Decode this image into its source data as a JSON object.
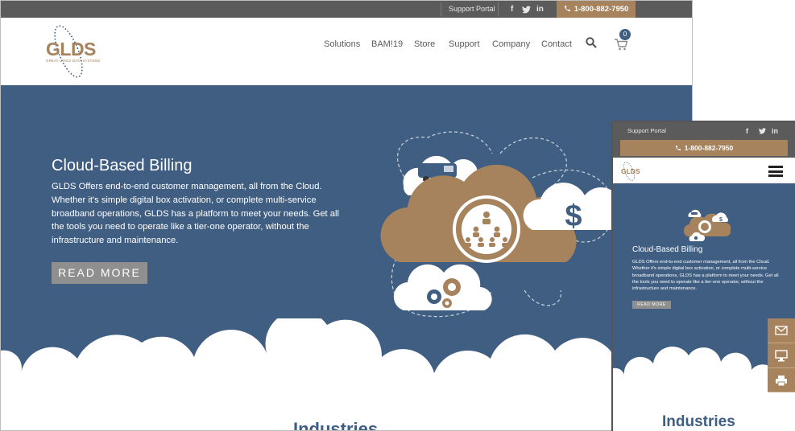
{
  "desktop": {
    "topbar": {
      "support_portal": "Support Portal",
      "social": [
        "f",
        "t",
        "in"
      ],
      "phone": "1-800-882-7950"
    },
    "logo": {
      "text": "GLDS",
      "tagline": "GREAT LAKES DATA SYSTEMS"
    },
    "nav": [
      "Solutions",
      "BAM!19",
      "Store",
      "Support",
      "Company",
      "Contact"
    ],
    "cart_count": "0",
    "hero": {
      "title": "Cloud-Based Billing",
      "body": "GLDS Offers end-to-end customer management, all from the Cloud. Whether it's simple digital box activation, or complete multi-service broadband operations, GLDS has a platform to meet your needs. Get all the tools you need to operate like a tier-one operator, without the infrastructure and maintenance.",
      "button": "READ MORE"
    },
    "section_heading": "Industries"
  },
  "mobile": {
    "support_portal": "Support Portal",
    "social": [
      "f",
      "t",
      "in"
    ],
    "phone": "1-800-882-7950",
    "logo_text": "GLDS",
    "hero_title": "Cloud-Based Billing",
    "hero_body": "GLDS Offers end-to-end customer management, all from the Cloud. Whether it's simple digital box activation, or complete multi-service broadband operations, GLDS has a platform to meet your needs. Get all the tools you need to operate like a tier-one operator, without the infrastructure and maintenance.",
    "button": "READ MORE",
    "section_heading": "Industries"
  },
  "side_actions": [
    "envelope-icon",
    "monitor-icon",
    "printer-icon"
  ],
  "colors": {
    "brand_blue": "#3f5e82",
    "brand_tan": "#a6835d",
    "topbar": "#5b5b5b"
  }
}
